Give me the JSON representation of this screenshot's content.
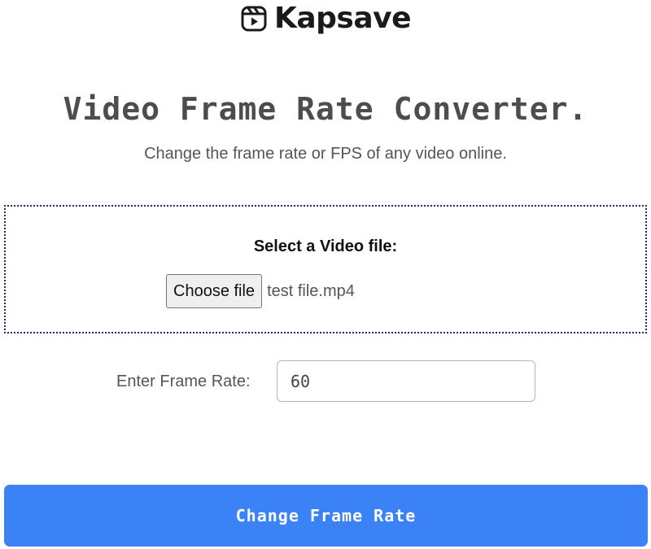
{
  "brand": {
    "name": "Kapsave",
    "icon": "video-play-icon"
  },
  "header": {
    "title": "Video Frame Rate Converter.",
    "subtitle": "Change the frame rate or FPS of any video online."
  },
  "upload": {
    "label": "Select a Video file:",
    "button_label": "Choose file",
    "file_name": "test file.mp4"
  },
  "frame_rate": {
    "label": "Enter Frame Rate:",
    "value": "60"
  },
  "submit": {
    "label": "Change Frame Rate"
  },
  "colors": {
    "accent": "#3b82f6",
    "dropzone_border": "#1e2a78",
    "title_text": "#4d4d4d"
  }
}
